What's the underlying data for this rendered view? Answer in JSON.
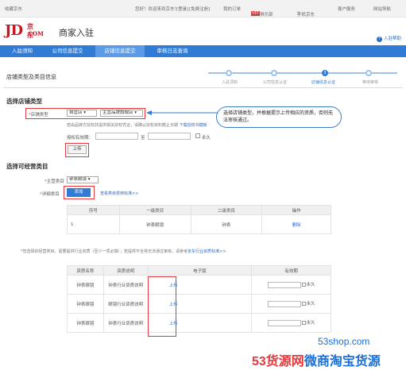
{
  "topbar": {
    "favorite": "收藏京东",
    "welcome": "您好！欢迎来到京东！",
    "login": "[登录]",
    "register": "[免费注册]",
    "orders": "我的订单",
    "vip": "会员俱乐部",
    "mobile": "手机京东",
    "service": "客户服务",
    "sitenav": "网站导航"
  },
  "header": {
    "logo_jd": "JD",
    "logo_cn": "京东",
    "logo_com": ".COM",
    "title": "商家入驻",
    "help": "入驻帮助"
  },
  "nav": {
    "tabs": [
      {
        "label": "入驻须知"
      },
      {
        "label": "公司信息提交"
      },
      {
        "label": "店铺信息提交"
      },
      {
        "label": "审核日志查询"
      }
    ]
  },
  "section_title": "店铺类型及类目信息",
  "steps": [
    {
      "label": "入驻须知"
    },
    {
      "label": "公司信息认证"
    },
    {
      "label": "店铺信息认证"
    },
    {
      "label": "等待审核"
    }
  ],
  "current_step_number": "3",
  "shop_type": {
    "heading": "选择店铺类型",
    "label": "店铺类型",
    "select1": "自营店",
    "select2": "主营品牌旗舰店",
    "note": "若由品牌方授权并提供相关授权凭证，请确认授权资料截止日期",
    "note_link": "下载授权书模板",
    "date_label": "授权有效期：",
    "date_sep": "至",
    "forever": "永久",
    "upload": "上传"
  },
  "callout": "选择店铺类型，并根据提示上传相应的资质，否则无法审核通过。",
  "category": {
    "heading": "选择可经营类目",
    "main_label": "主营类目",
    "main_value": "钟表眼镜",
    "detail_label": "详细类目",
    "add_btn": "添加",
    "standard_link": "查看类目费用标准>>",
    "headers": [
      "序号",
      "一级类目",
      "二级类目",
      "操作"
    ],
    "rows": [
      {
        "no": "1",
        "cat1": "钟表眼镜",
        "cat2": "钟表",
        "op": "删除"
      }
    ]
  },
  "qualification": {
    "note": "*您选择的经营类目，需要提供行业资质（至少一项必填）；若提供不全将无法通过审核，请参考",
    "note_link": "京东行业资质标准>>",
    "headers": [
      "资质名称",
      "资质说明",
      "电子版",
      "有效期"
    ],
    "rows": [
      {
        "name": "钟表眼镜",
        "desc": "钟表行业资质说明",
        "upload": "上传",
        "forever": "永久"
      },
      {
        "name": "钟表眼镜",
        "desc": "眼镜行业资质说明",
        "upload": "上传",
        "forever": "永久"
      },
      {
        "name": "钟表眼镜",
        "desc": "钟表行业资质说明",
        "upload": "上传",
        "forever": "永久"
      }
    ]
  },
  "watermark": {
    "line1": "53shop.com",
    "line2a": "53货源网",
    "line2b": "微商淘宝货源"
  },
  "colors": {
    "brand": "#c81623",
    "accent": "#2f7bd6",
    "highlight": "#e4393c"
  }
}
